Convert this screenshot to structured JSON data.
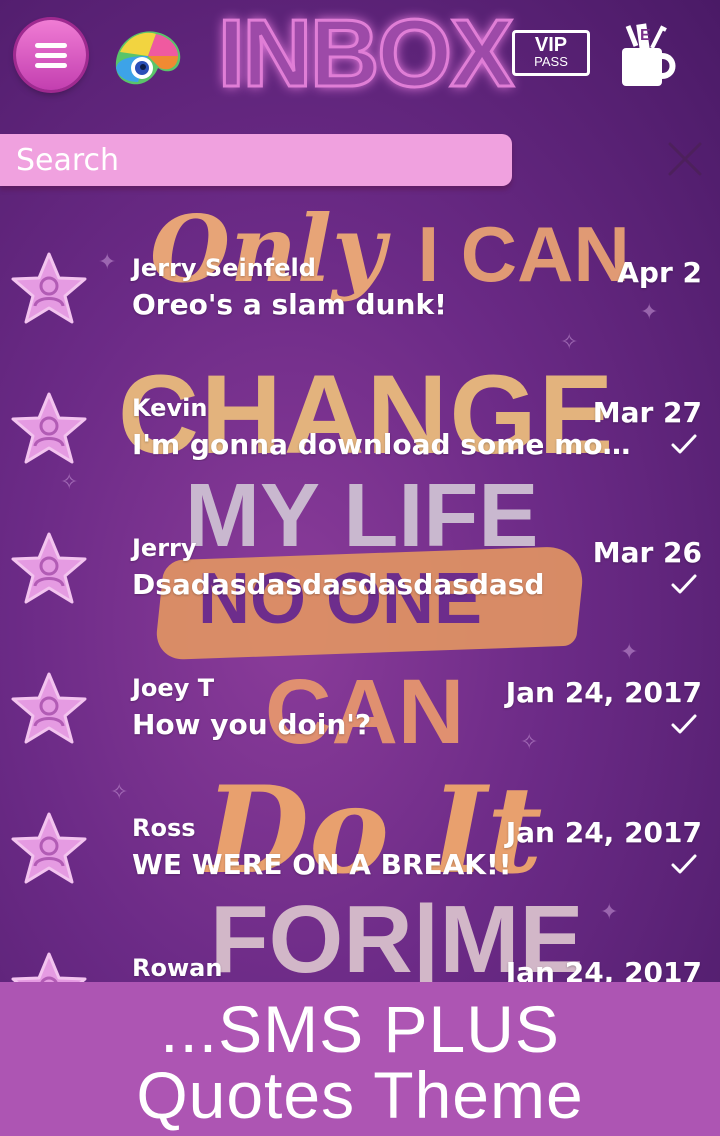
{
  "header": {
    "title": "INBOX",
    "vip_line1": "VIP",
    "vip_line2": "PASS",
    "menu_icon": "hamburger-menu-icon",
    "theme_icon": "chameleon-theme-icon",
    "vip_icon": "vip-pass-ticket-icon",
    "tools_icon": "mug-with-tools-icon"
  },
  "search": {
    "placeholder": "Search",
    "value": "",
    "clear_icon": "close-icon"
  },
  "background_quote": {
    "line1": "Only",
    "line1b": "I CAN",
    "line2": "CHANGE",
    "line3": "MY LIFE",
    "line4": "NO ONE",
    "line5": "CAN",
    "line6": "Do It",
    "line7": "FOR|ME"
  },
  "conversations": [
    {
      "name": "Jerry Seinfeld",
      "snippet": "Oreo's a slam dunk!",
      "date": "Apr 2",
      "read_check": false
    },
    {
      "name": "Kevin",
      "snippet": "I'm gonna download some mo…",
      "date": "Mar 27",
      "read_check": true
    },
    {
      "name": "Jerry",
      "snippet": "Dsadasdasdasdasdasdasd",
      "date": "Mar 26",
      "read_check": true
    },
    {
      "name": "Joey T",
      "snippet": "How you doin'?",
      "date": "Jan 24, 2017",
      "read_check": true
    },
    {
      "name": "Ross",
      "snippet": "WE WERE ON A BREAK!!",
      "date": "Jan 24, 2017",
      "read_check": true
    },
    {
      "name": "Rowan",
      "snippet": "",
      "date": "Jan 24, 2017",
      "read_check": false
    }
  ],
  "banner": {
    "line1": "...SMS PLUS",
    "line2": "Quotes Theme"
  },
  "colors": {
    "background": "#6b2a86",
    "accent_pink": "#f0a1df",
    "banner": "#ad55b3",
    "avatar_star": "#e59be2"
  }
}
